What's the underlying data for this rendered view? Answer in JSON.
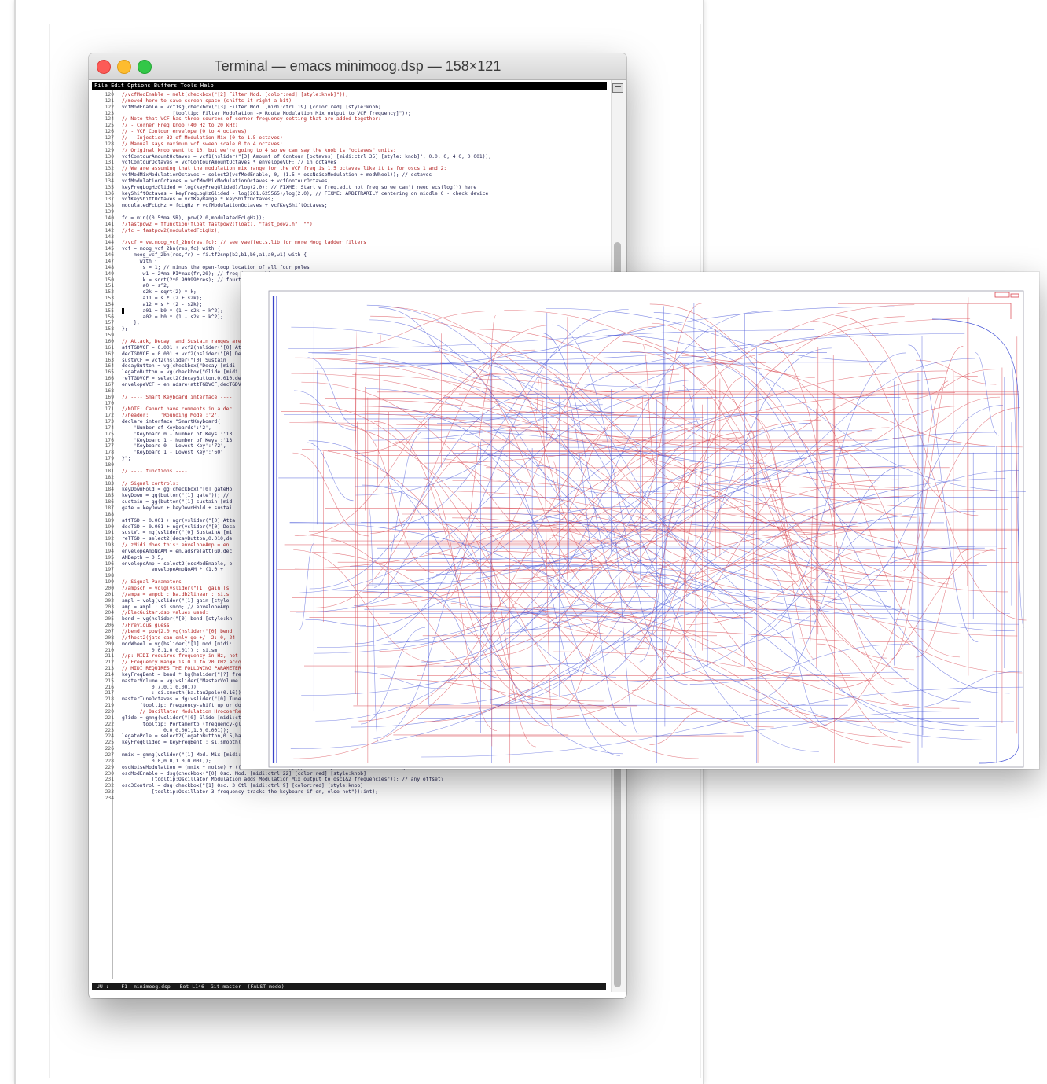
{
  "window": {
    "title": "Terminal — emacs minimoog.dsp — 158×121"
  },
  "emacs": {
    "menu": "File Edit Options Buffers Tools Help",
    "modeline": "-UU-:----F1  minimoog.dsp   Bot L146  Git-master  (FAUST mode) ----------------------------------------------------------------------",
    "lines": [
      {
        "n": "120",
        "t": "//vcfModEnable = melt(checkbox(\"[2] Filter Mod. [color:red] [style:knob]\"));"
      },
      {
        "n": "121",
        "t": "//moved here to save screen space (shifts it right a bit)"
      },
      {
        "n": "122",
        "t": "vcfModEnable = vcf1sg(checkbox(\"[3] Filter Mod. [midi:ctrl 19] [color:red] [style:knob]"
      },
      {
        "n": "123",
        "t": "                 [tooltip: Filter Modulation -> Route Modulation Mix output to VCF frequency]\"));"
      },
      {
        "n": "124",
        "t": "// Note that VCF has three sources of corner-frequency setting that are added together:"
      },
      {
        "n": "125",
        "t": "// - Corner Freq knob (40 Hz to 20 kHz)"
      },
      {
        "n": "126",
        "t": "// - VCF Contour envelope (0 to 4 octaves)"
      },
      {
        "n": "127",
        "t": "// - Injection 32 of Modulation Mix (0 to 1.5 octaves)"
      },
      {
        "n": "128",
        "t": "// Manual says maximum vcf sweep scale 0 to 4 octaves:"
      },
      {
        "n": "129",
        "t": "// Original knob went to 10, but we're going to 4 so we can say the knob is \"octaves\" units:"
      },
      {
        "n": "130",
        "t": "vcfContourAmountOctaves = vcf1(hslider(\"[3] Amount of Contour [octaves] [midi:ctrl 35] [style: knob]\", 0.0, 0, 4.0, 0.001));"
      },
      {
        "n": "131",
        "t": "vcfContourOctaves = vcfContourAmountOctaves * envelopeVCF; // in octaves"
      },
      {
        "n": "132",
        "t": "// We are assuming that the modulation mix range for the VCF freq is 1.5 octaves like it is for oscs 1 and 2:"
      },
      {
        "n": "133",
        "t": "vcfModMixModulationOctaves = select2(vcfModEnable, 0, (1.5 * oscNoiseModulation + modWheel)); // octaves"
      },
      {
        "n": "134",
        "t": "vcfModulationOctaves = vcfModMixModulationOctaves + vcfContourOctaves;"
      },
      {
        "n": "135",
        "t": "keyFreqLogHzGlided = log(keyFreqGlided)/log(2.0); // FIXME: Start w freq.edit not freq so we can't need ecs(log()) here"
      },
      {
        "n": "136",
        "t": "keyShiftOctaves = keyFreqLogHzGlided - log(261.625565)/log(2.0); // FIXME: ARBITRARILY centering on middle C - check device"
      },
      {
        "n": "137",
        "t": "vcfKeyShiftOctaves = vcfKeyRange * keyShiftOctaves;"
      },
      {
        "n": "138",
        "t": "modulatedFcLgHz = fcLgHz + vcfModulationOctaves + vcfKeyShiftOctaves;"
      },
      {
        "n": "139",
        "t": ""
      },
      {
        "n": "140",
        "t": "fc = min((0.5*ma.SR), pow(2.0,modulatedFcLgHz));"
      },
      {
        "n": "141",
        "t": "//fastpow2 = ffunction(float fastpow2(float), \"fast_pow2.h\", \"\");"
      },
      {
        "n": "142",
        "t": "//fc = fastpow2(modulatedFcLgHz);"
      },
      {
        "n": "143",
        "t": ""
      },
      {
        "n": "144",
        "t": "//vcf = ve.moog_vcf_2bn(res,fc); // see vaeffects.lib for more Moog ladder filters"
      },
      {
        "n": "145",
        "t": "vcf = moog_vcf_2bn(res,fc) with {"
      },
      {
        "n": "146",
        "t": "    moog_vcf_2bn(res,fr) = fi.tf2snp(b2,b1,b0,a1,a0,w1) with {"
      },
      {
        "n": "147",
        "t": "      with {"
      },
      {
        "n": "148",
        "t": "       s = 1; // minus the open-loop location of all four poles"
      },
      {
        "n": "149",
        "t": "       w1 = 2*ma.PI*max(fr,20); // freq to normalize"
      },
      {
        "n": "150",
        "t": "       k = sqrt(2*0.99999*res); // fourth-root of"
      },
      {
        "n": "151",
        "t": "       a0 = s^2;"
      },
      {
        "n": "152",
        "t": "       s2k = sqrt(2) * k;"
      },
      {
        "n": "153",
        "t": "       a11 = s * (2 + s2k);"
      },
      {
        "n": "154",
        "t": "       a12 = s * (2 - s2k);"
      },
      {
        "n": "155",
        "t": "       a01 = b0 * (1 + s2k + k^2);"
      },
      {
        "n": "156",
        "t": "       a02 = b0 * (1 - s2k + k^2);"
      },
      {
        "n": "157",
        "t": "    };"
      },
      {
        "n": "158",
        "t": "};"
      },
      {
        "n": "159",
        "t": ""
      },
      {
        "n": "160",
        "t": "// Attack, Decay, and Sustain ranges are set by the following knobs"
      },
      {
        "n": "161",
        "t": "attTGDVCF = 0.001 + vcf2(hslider(\"[0] Attack"
      },
      {
        "n": "162",
        "t": "decTGDVCF = 0.001 + vcf2(hslider(\"[0] Decay"
      },
      {
        "n": "163",
        "t": "sustVCF = vcf2(hslider(\"[0] Sustain"
      },
      {
        "n": "164",
        "t": "decayButton = vg(checkbox(\"Decay [midi"
      },
      {
        "n": "165",
        "t": "legatoButton = vg(checkbox(\"Glide [midi"
      },
      {
        "n": "166",
        "t": "relTGDVCF = select2(decayButton,0.010,de"
      },
      {
        "n": "167",
        "t": "envelopeVCF = en.adsre(attTGDVCF,decTGDVC"
      },
      {
        "n": "168",
        "t": ""
      },
      {
        "n": "169",
        "t": "// ---- Smart Keyboard interface ----"
      },
      {
        "n": "170",
        "t": ""
      },
      {
        "n": "171",
        "t": "//NOTE: Cannot have comments in a dec"
      },
      {
        "n": "172",
        "t": "//header:    'Rounding Mode':'2',"
      },
      {
        "n": "173",
        "t": "declare interface \"SmartKeyboard{"
      },
      {
        "n": "174",
        "t": "    'Number of Keyboards':'2',"
      },
      {
        "n": "175",
        "t": "    'Keyboard 0 - Number of Keys':'13"
      },
      {
        "n": "176",
        "t": "    'Keyboard 1 - Number of Keys':'13"
      },
      {
        "n": "177",
        "t": "    'Keyboard 0 - Lowest Key':'72',"
      },
      {
        "n": "178",
        "t": "    'Keyboard 1 - Lowest Key':'60'"
      },
      {
        "n": "179",
        "t": "}\";"
      },
      {
        "n": "180",
        "t": ""
      },
      {
        "n": "181",
        "t": "// ---- functions ----"
      },
      {
        "n": "182",
        "t": ""
      },
      {
        "n": "183",
        "t": "// Signal controls:"
      },
      {
        "n": "184",
        "t": "keyDownHold = gg(checkbox(\"[0] gateHo"
      },
      {
        "n": "185",
        "t": "keyDown = gg(button(\"[1] gate\")); //"
      },
      {
        "n": "186",
        "t": "sustain = gg(button(\"[1] sustain [mid"
      },
      {
        "n": "187",
        "t": "gate = keyDown + keyDownHold + sustai"
      },
      {
        "n": "188",
        "t": ""
      },
      {
        "n": "189",
        "t": "attTGD = 0.001 + ngr(vslider(\"[0] Atta"
      },
      {
        "n": "190",
        "t": "decTGD = 0.001 + ngr(vslider(\"[0] Deca"
      },
      {
        "n": "191",
        "t": "sustVl = ng(vslider(\"[0] SustainA [mi"
      },
      {
        "n": "192",
        "t": "relTGD = select2(decayButton,0.010,de"
      },
      {
        "n": "193",
        "t": "// zMidi does this: envelopeAmp = en."
      },
      {
        "n": "194",
        "t": "envelopeAmpNoAM = en.adsre(attTGD,dec"
      },
      {
        "n": "195",
        "t": "AMDepth = 0.5;"
      },
      {
        "n": "196",
        "t": "envelopeAmp = select2(oscModEnable, e"
      },
      {
        "n": "197",
        "t": "          envelopeAmpNoAM * (1.0 +"
      },
      {
        "n": "198",
        "t": ""
      },
      {
        "n": "199",
        "t": "// Signal Parameters"
      },
      {
        "n": "200",
        "t": "//ampsch = volg(vslider(\"[1] gain [s"
      },
      {
        "n": "201",
        "t": "//ampa = ampdb : ba.db2linear : si.s"
      },
      {
        "n": "202",
        "t": "ampl = volg(vslider(\"[1] gain [style"
      },
      {
        "n": "203",
        "t": "amp = ampl : si.smoo; // envelopeAmp"
      },
      {
        "n": "204",
        "t": "//ElecGuitar.dsp values used:"
      },
      {
        "n": "205",
        "t": "bend = vg(hslider(\"[0] bend [style:kn"
      },
      {
        "n": "206",
        "t": "//Previous guess:"
      },
      {
        "n": "207",
        "t": "//bend = pow(2.0,vg(hslider(\"[0] bend"
      },
      {
        "n": "208",
        "t": "//fhost2(jate can only go +/- 2: 0,-24"
      },
      {
        "n": "209",
        "t": "modWheel = vg(hslider(\"[1] mod [midi:"
      },
      {
        "n": "210",
        "t": "          0.0,1.0,0.01)) : si.sm"
      },
      {
        "n": "211",
        "t": "//p: MIDI requires frequency in Hz, not piano-keys as we had before"
      },
      {
        "n": "212",
        "t": "// Frequency Range is 0.1 to 20 kHz according to the Minimoog manual:"
      },
      {
        "n": "213",
        "t": "// MIDI REQUIRES THE FOLLOWING PARAMETER TO BE NAMED \"freq\":"
      },
      {
        "n": "214",
        "t": "keyFreqBent = bend * kg(hslider(\"[?] freq [unit:Hz] [style:knob]\",220,0.1,20000,0.1));"
      },
      {
        "n": "215",
        "t": "masterVolume = vg(vslider(\"MasterVolume [style:knob] [midi: ctrl 7] [tooltip: master volume, MIDI controller]\","
      },
      {
        "n": "216",
        "t": "          0.7,0,1,0.001))"
      },
      {
        "n": "217",
        "t": "          : si.smooth(ba.tau2pole(0.16));"
      },
      {
        "n": "218",
        "t": "masterTuneOctaves = dg(vslider(\"[0] Tune [midi:ctrl 47] [unit:Octaves] [style:knob]"
      },
      {
        "n": "219",
        "t": "      [tooltip: Frequency-shift up or down for all oscillators in Octaves]\", 0.0,-1.0,1.0,0.001));"
      },
      {
        "n": "220",
        "t": "      // Oscillator Modulation HrocoerRed -> apply Modulation Mix output osc1&2 pitches"
      },
      {
        "n": "221",
        "t": "glide = gmng(vslider(\"[0] Glide [midi:ctrl 5] [unit:sec/octave] [style:knob] [scale:log]"
      },
      {
        "n": "222",
        "t": "      [tooltip: Portamento (frequency-glide) in seconds per octave]\","
      },
      {
        "n": "223",
        "t": "              0.0,0.001,1.0,0.001));"
      },
      {
        "n": "224",
        "t": "legatoPole = select2(legatoButton,0.5,ba.tau2pole(glideavss(1.0f)/2.0f)); // convert 1/e to 1/2 by allowing down exp"
      },
      {
        "n": "225",
        "t": "keyFreqGlided = keyFreqBent : si.smooth(legatoPole);"
      },
      {
        "n": "226",
        "t": ""
      },
      {
        "n": "227",
        "t": "mmix = gmng(vslider(\"[1] Mod. Mix [midi:ctrl 40] [style:knob] [tooltip: Modulation Mix: Osc3 (0) to Noise (1)]\","
      },
      {
        "n": "228",
        "t": "          0.0,0.0,1.0,0.001));"
      },
      {
        "n": "229",
        "t": "oscNoiseModulation = (mmix * noise) + ((1.0-mmix) * osc3); // noise amplitude and off-switch ignored here"
      },
      {
        "n": "230",
        "t": "oscModEnable = dsg(checkbox(\"[0] Osc. Mod. [midi:ctrl 22] [color:red] [style:knob]"
      },
      {
        "n": "231",
        "t": "          [tooltip:Oscillator Modulation adds Modulation Mix output to osc1&2 frequencies\")); // any offset?"
      },
      {
        "n": "232",
        "t": "osc3Control = dsg(checkbox(\"[1] Osc. 3 Ctl [midi:ctrl 9] [color:red] [style:knob]"
      },
      {
        "n": "233",
        "t": "          [tooltip:Oscillator 3 frequency tracks the keyboard if on, else not\")):int);"
      },
      {
        "n": "234",
        "t": ""
      }
    ]
  }
}
